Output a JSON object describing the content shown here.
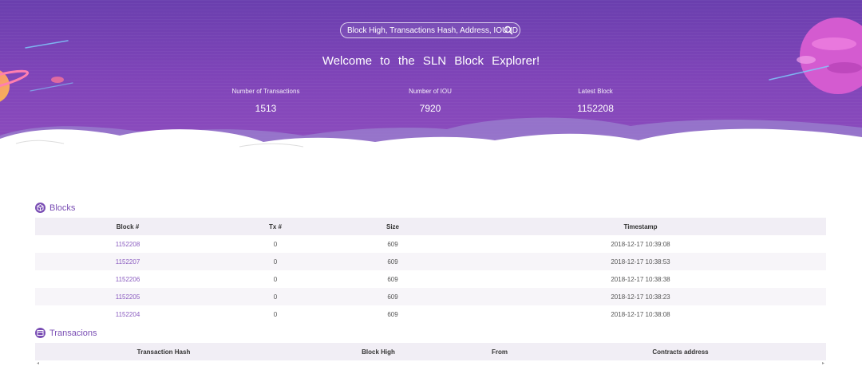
{
  "search": {
    "placeholder": "Block High, Transactions Hash, Address, IOU ID"
  },
  "hero": {
    "welcome": "Welcome to the SLN Block Explorer!"
  },
  "stats": [
    {
      "label": "Number of Transactions",
      "value": "1513"
    },
    {
      "label": "Number of IOU",
      "value": "7920"
    },
    {
      "label": "Latest Block",
      "value": "1152208"
    }
  ],
  "blocks": {
    "title": "Blocks",
    "headers": [
      "Block #",
      "Tx #",
      "Size",
      "Timestamp"
    ],
    "rows": [
      [
        "1152208",
        "0",
        "609",
        "2018-12-17 10:39:08"
      ],
      [
        "1152207",
        "0",
        "609",
        "2018-12-17 10:38:53"
      ],
      [
        "1152206",
        "0",
        "609",
        "2018-12-17 10:38:38"
      ],
      [
        "1152205",
        "0",
        "609",
        "2018-12-17 10:38:23"
      ],
      [
        "1152204",
        "0",
        "609",
        "2018-12-17 10:38:08"
      ]
    ]
  },
  "transactions": {
    "title": "Transacions",
    "headers": [
      "Transaction Hash",
      "Block High",
      "From",
      "Contracts address"
    ]
  },
  "colors": {
    "accent": "#7a4eb4",
    "hero_top": "#6a3fae",
    "hero_bottom": "#8f4dbe"
  }
}
